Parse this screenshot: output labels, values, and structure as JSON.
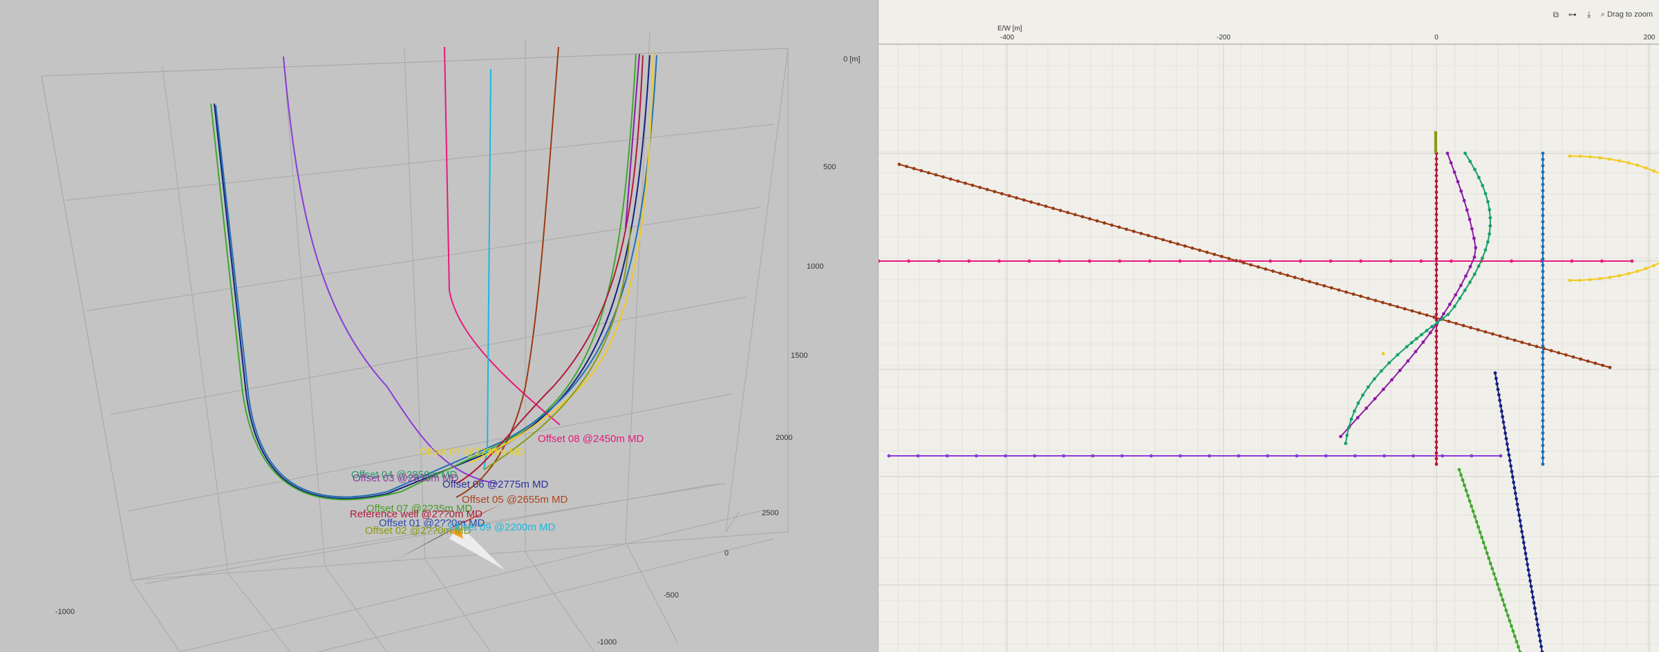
{
  "view3d": {
    "axis_labels": {
      "depth": [
        "0 [m]",
        "500",
        "1000",
        "1500",
        "2000",
        "2500"
      ],
      "ns": [
        "0",
        "-500",
        "-1000"
      ],
      "ew": [
        "-1000"
      ]
    },
    "well_labels": [
      {
        "text": "Offset 08 @2450m MD",
        "color": "#e8197e"
      },
      {
        "text": "Offset 0? @2??0m MD",
        "color": "#e8d22a"
      },
      {
        "text": "Offset 04 @2850m MD",
        "color": "#2a9a6a"
      },
      {
        "text": "Offset 03 @2820m MD",
        "color": "#8a3a9a"
      },
      {
        "text": "Offset 06 @2775m MD",
        "color": "#2b2f9a"
      },
      {
        "text": "Offset 05 @2655m MD",
        "color": "#b0431c"
      },
      {
        "text": "Offset 07 @2?35m MD",
        "color": "#4a9a2a"
      },
      {
        "text": "Reference well @2??0m MD",
        "color": "#b01a3a"
      },
      {
        "text": "Offset 01 @2??0m MD",
        "color": "#2a4aa8"
      },
      {
        "text": "Offset 02 @2??0m MD",
        "color": "#8a9a10"
      },
      {
        "text": "Offset 09 @2200m MD",
        "color": "#19b8e0"
      }
    ]
  },
  "plan": {
    "toolbar": {
      "icons": [
        "layers-icon",
        "pan-icon",
        "download-icon"
      ],
      "zoom_label": "Drag to zoom"
    },
    "axis_title": "E/W [m]",
    "x_ticks": [
      "-400",
      "-200",
      "0",
      "200"
    ]
  },
  "colors": {
    "reference": "#b01a3a",
    "offset01": "#1f6fb0",
    "offset02": "#8a9a10",
    "offset03": "#8e1aa8",
    "offset04": "#17a06a",
    "offset05": "#9a3a12",
    "offset06": "#142080",
    "offset07": "#3ea82a",
    "offset08": "#e8197e",
    "offset09": "#19b8e0",
    "offset10": "#f2cc20",
    "offsetP": "#8a3ad8"
  }
}
